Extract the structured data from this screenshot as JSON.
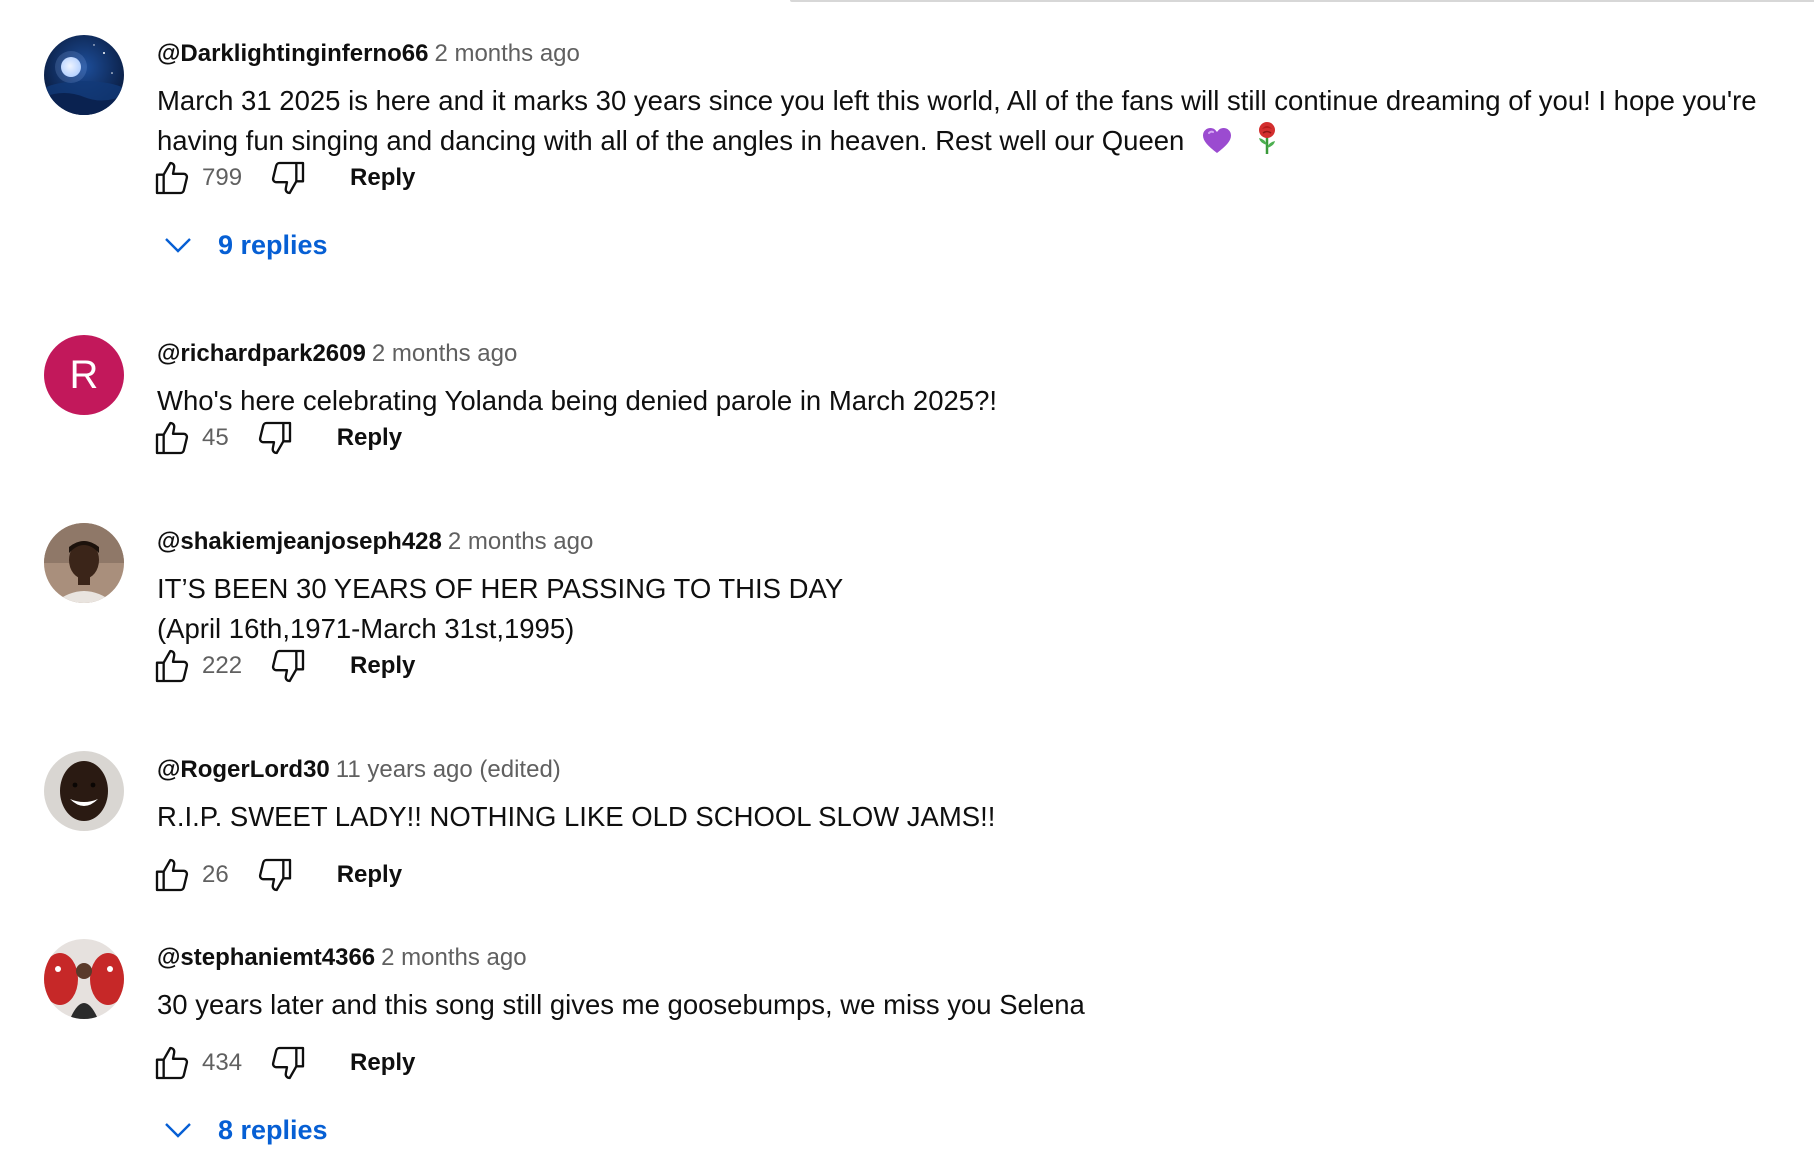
{
  "comments": [
    {
      "author": "@Darklightinginferno66",
      "time": "2 months ago",
      "lines": [
        "March 31 2025 is here and it marks 30 years since you left this world, All of the fans will still continue dreaming of you! I hope you're having fun singing and dancing with all of the angles in heaven. Rest well our Queen"
      ],
      "emojis": [
        "purple-heart",
        "rose"
      ],
      "likes": "799",
      "reply_label": "Reply",
      "replies_label": "9 replies",
      "avatar": "moon-icon"
    },
    {
      "author": "@richardpark2609",
      "time": "2 months ago",
      "lines": [
        "Who's here celebrating Yolanda being denied parole in March 2025?!"
      ],
      "likes": "45",
      "reply_label": "Reply",
      "avatar_letter": "R",
      "avatar_color": "#c2185b"
    },
    {
      "author": "@shakiemjeanjoseph428",
      "time": "2 months ago",
      "lines": [
        "IT’S BEEN 30 YEARS OF HER PASSING TO THIS DAY",
        "(April 16th,1971-March 31st,1995)"
      ],
      "likes": "222",
      "reply_label": "Reply",
      "avatar": "person-photo-icon"
    },
    {
      "author": "@RogerLord30",
      "time": "11 years ago (edited)",
      "lines": [
        "R.I.P. SWEET LADY!! NOTHING LIKE OLD SCHOOL SLOW JAMS!!"
      ],
      "likes": "26",
      "reply_label": "Reply",
      "avatar": "smiling-person-icon"
    },
    {
      "author": "@stephaniemt4366",
      "time": "2 months ago",
      "lines": [
        "30 years later and this song still gives me goosebumps, we miss you Selena"
      ],
      "likes": "434",
      "reply_label": "Reply",
      "replies_label": "8 replies",
      "avatar": "group-photo-icon"
    }
  ],
  "colors": {
    "link_blue": "#065fd4",
    "secondary_text": "#606060",
    "primary_text": "#0f0f0f"
  }
}
